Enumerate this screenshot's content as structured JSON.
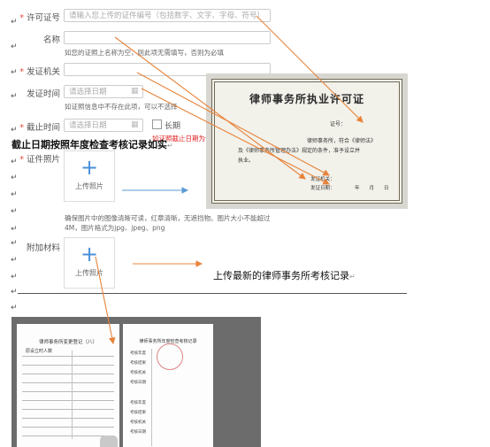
{
  "form": {
    "license_no": {
      "label": "许可证号",
      "placeholder": "请输入您上传的证件编号（包括数字、文字、字母、符号）"
    },
    "name": {
      "label": "名称",
      "hint": "如您的证照上名称为空，则此项无需填写，否则为必填"
    },
    "issuer": {
      "label": "发证机关"
    },
    "issue_date": {
      "label": "发证时间",
      "placeholder": "请选择日期",
      "hint": "如证照信息中不存在此项，可以不选择"
    },
    "expiry_date": {
      "label": "截止时间",
      "placeholder": "请选择日期",
      "long_term": "长期",
      "red_note": "如证照截止日期为长"
    },
    "photo": {
      "label": "证件照片",
      "upload_label": "上传照片",
      "hint_line1": "确保图片中的图像清晰可读，红章清晰，无遮挡物。图片大小不能超过",
      "hint_line2": "4M，图片格式为jpg、jpeg、png"
    },
    "attachments": {
      "label": "附加材料",
      "upload_label": "上传照片"
    }
  },
  "annotations": {
    "expiry_note": "截止日期按照年度检查考核记录如实",
    "latest_record": "上传最新的律师事务所考核记录"
  },
  "certificate": {
    "title": "律师事务所执业许可证",
    "cert_no": "证号：",
    "line1": "律师事务所，符合《律师法》",
    "line2": "及《律师事务所管理办法》规定的条件，准予设立并",
    "line3": "执业。",
    "issuer": "发证机关：",
    "issue_date": "发证日期：",
    "date_units": "年　　月　　日"
  },
  "record_book": {
    "left_title": "律师事务所变更登记（八）",
    "left_header": "原设立时人数",
    "right_title": "律师事务所年度检查考核记录",
    "row_labels": [
      "考核年度",
      "考核结果",
      "考核机关",
      "考核日期",
      "考核年度",
      "考核结果",
      "考核机关",
      "考核日期"
    ]
  },
  "colors": {
    "required": "#e74c3c",
    "arrow": "#e8833a",
    "blue_arrow": "#5b9bd5",
    "red_note": "#e02020"
  }
}
